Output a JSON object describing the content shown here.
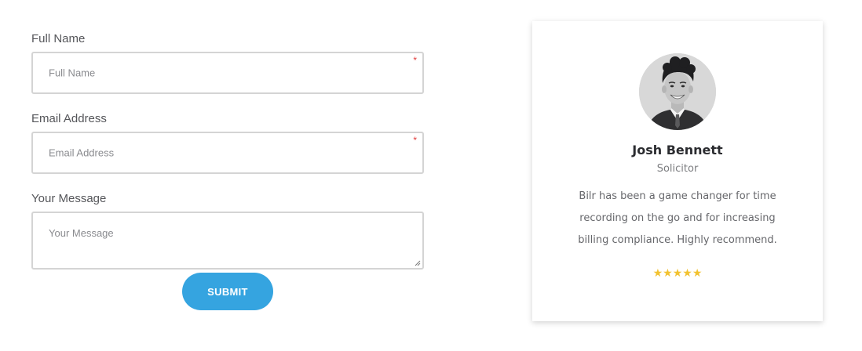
{
  "form": {
    "full_name": {
      "label": "Full Name",
      "placeholder": "Full Name",
      "required_marker": "*"
    },
    "email": {
      "label": "Email Address",
      "placeholder": "Email Address",
      "required_marker": "*"
    },
    "message": {
      "label": "Your Message",
      "placeholder": "Your Message"
    },
    "submit_label": "SUBMIT"
  },
  "testimonial": {
    "name": "Josh Bennett",
    "role": "Solicitor",
    "quote": "Bilr has been a game changer for time recording on the go and for increasing billing compliance. Highly recommend.",
    "rating": 5,
    "stars_text": "★★★★★",
    "avatar_icon": "person-photo-icon"
  },
  "colors": {
    "accent": "#35a4e0",
    "star": "#f2c230",
    "required": "#e23b3b"
  }
}
